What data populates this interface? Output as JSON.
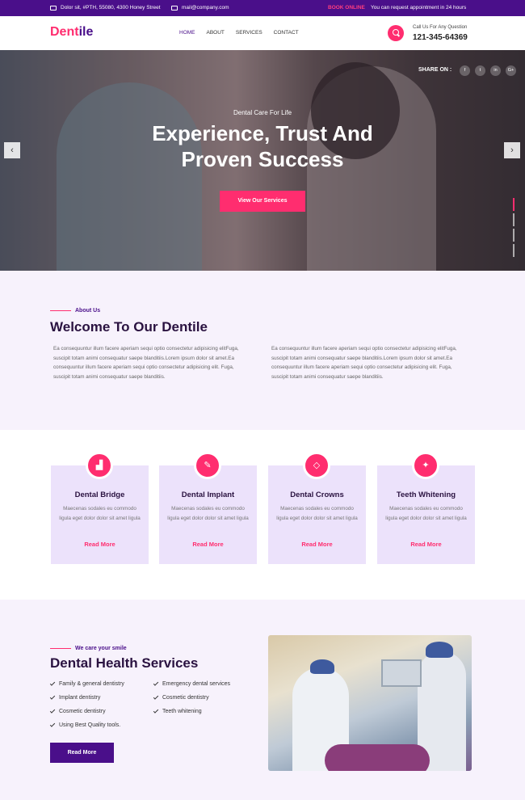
{
  "topbar": {
    "address": "Dolor sit, #PTH, 55080, 4300 Honey Street",
    "email": "mail@company.com",
    "book": "BOOK ONLINE",
    "request": "You can request appointment in 24 hours"
  },
  "header": {
    "logo_main": "Dent",
    "logo_accent": "ile",
    "nav": [
      "HOME",
      "ABOUT",
      "SERVICES",
      "CONTACT"
    ],
    "call_label": "Call Us For Any Question",
    "phone": "121-345-64369"
  },
  "hero": {
    "share": "SHARE ON :",
    "social": [
      "f",
      "t",
      "in",
      "G+"
    ],
    "subtitle": "Dental Care For Life",
    "title_line1": "Experience, Trust And",
    "title_line2": "Proven Success",
    "button": "View Our Services",
    "prev": "‹",
    "next": "›"
  },
  "about": {
    "label": "About Us",
    "title": "Welcome To Our Dentile",
    "para1": "Ea consequuntur illum facere aperiam sequi optio consectetur adipisicing elitFuga, suscipit totam animi consequatur saepe blanditiis.Lorem ipsum dolor sit amet.Ea consequuntur illum facere aperiam sequi optio consectetur adipisicing elit. Fuga, suscipit totam animi consequatur saepe blanditiis.",
    "para2": "Ea consequuntur illum facere aperiam sequi optio consectetur adipisicing elitFuga, suscipit totam animi consequatur saepe blanditiis.Lorem ipsum dolor sit amet.Ea consequuntur illum facere aperiam sequi optio consectetur adipisicing elit. Fuga, suscipit totam animi consequatur saepe blanditiis."
  },
  "services": {
    "cards": [
      {
        "icon": "bar-chart-icon",
        "glyph": "▟",
        "title": "Dental Bridge",
        "text": "Maecenas sodales eu commodo ligula eget dolor dolor sit amet ligula",
        "link": "Read More"
      },
      {
        "icon": "tooth-implant-icon",
        "glyph": "✎",
        "title": "Dental Implant",
        "text": "Maecenas sodales eu commodo ligula eget dolor dolor sit amet ligula",
        "link": "Read More"
      },
      {
        "icon": "diamond-icon",
        "glyph": "◇",
        "title": "Dental Crowns",
        "text": "Maecenas sodales eu commodo ligula eget dolor dolor sit amet ligula",
        "link": "Read More"
      },
      {
        "icon": "magic-wand-icon",
        "glyph": "✦",
        "title": "Teeth Whitening",
        "text": "Maecenas sodales eu commodo ligula eget dolor dolor sit amet ligula",
        "link": "Read More"
      }
    ]
  },
  "health": {
    "label": "We care your smile",
    "title": "Dental Health Services",
    "list_left": [
      "Family & general dentistry",
      "Implant dentistry",
      "Cosmetic dentistry",
      "Using Best Quality tools."
    ],
    "list_right": [
      "Emergency dental services",
      "Cosmetic dentistry",
      "Teeth whitening"
    ],
    "button": "Read More"
  },
  "colors": {
    "primary": "#4a0f8a",
    "accent": "#ff2d6f",
    "section_bg": "#f7f2fc",
    "card_bg": "#ece2fb"
  }
}
